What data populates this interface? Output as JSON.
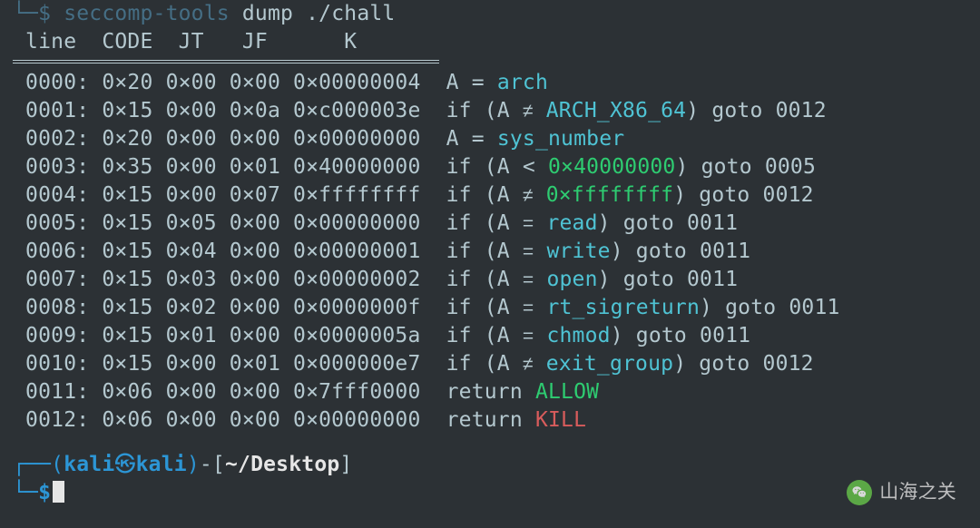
{
  "cmd": {
    "arrow": "└─$ ",
    "tool": "seccomp-tools",
    "sub": " dump ",
    "arg": "./chall"
  },
  "header": " line  CODE  JT   JF      K",
  "rows": [
    {
      "line": "0000",
      "code": "0×20",
      "jt": "0×00",
      "jf": "0×00",
      "k": "0×00000004",
      "desc": {
        "pre": "A = ",
        "hl": "arch",
        "post": ""
      }
    },
    {
      "line": "0001",
      "code": "0×15",
      "jt": "0×00",
      "jf": "0×0a",
      "k": "0×c000003e",
      "desc": {
        "pre": "if (A ",
        "op": "≠",
        "mid": " ",
        "hl": "ARCH_X86_64",
        "post": ") goto 0012"
      }
    },
    {
      "line": "0002",
      "code": "0×20",
      "jt": "0×00",
      "jf": "0×00",
      "k": "0×00000000",
      "desc": {
        "pre": "A = ",
        "hl": "sys_number",
        "post": ""
      }
    },
    {
      "line": "0003",
      "code": "0×35",
      "jt": "0×00",
      "jf": "0×01",
      "k": "0×40000000",
      "desc": {
        "pre": "if (A < ",
        "hl": "0×40000000",
        "post": ") goto 0005",
        "num": true
      }
    },
    {
      "line": "0004",
      "code": "0×15",
      "jt": "0×00",
      "jf": "0×07",
      "k": "0×ffffffff",
      "desc": {
        "pre": "if (A ",
        "op": "≠",
        "mid": " ",
        "hl": "0×ffffffff",
        "post": ") goto 0012",
        "num": true
      }
    },
    {
      "line": "0005",
      "code": "0×15",
      "jt": "0×05",
      "jf": "0×00",
      "k": "0×00000000",
      "desc": {
        "pre": "if (A ",
        "op": "=",
        "mid": " ",
        "hl": "read",
        "post": ") goto 0011"
      }
    },
    {
      "line": "0006",
      "code": "0×15",
      "jt": "0×04",
      "jf": "0×00",
      "k": "0×00000001",
      "desc": {
        "pre": "if (A ",
        "op": "=",
        "mid": " ",
        "hl": "write",
        "post": ") goto 0011"
      }
    },
    {
      "line": "0007",
      "code": "0×15",
      "jt": "0×03",
      "jf": "0×00",
      "k": "0×00000002",
      "desc": {
        "pre": "if (A ",
        "op": "=",
        "mid": " ",
        "hl": "open",
        "post": ") goto 0011"
      }
    },
    {
      "line": "0008",
      "code": "0×15",
      "jt": "0×02",
      "jf": "0×00",
      "k": "0×0000000f",
      "desc": {
        "pre": "if (A ",
        "op": "=",
        "mid": " ",
        "hl": "rt_sigreturn",
        "post": ") goto 0011"
      }
    },
    {
      "line": "0009",
      "code": "0×15",
      "jt": "0×01",
      "jf": "0×00",
      "k": "0×0000005a",
      "desc": {
        "pre": "if (A ",
        "op": "=",
        "mid": " ",
        "hl": "chmod",
        "post": ") goto 0011"
      }
    },
    {
      "line": "0010",
      "code": "0×15",
      "jt": "0×00",
      "jf": "0×01",
      "k": "0×000000e7",
      "desc": {
        "pre": "if (A ",
        "op": "≠",
        "mid": " ",
        "hl": "exit_group",
        "post": ") goto 0012"
      }
    },
    {
      "line": "0011",
      "code": "0×06",
      "jt": "0×00",
      "jf": "0×00",
      "k": "0×7fff0000",
      "desc": {
        "pre": "return ",
        "hl": "ALLOW",
        "post": ""
      }
    },
    {
      "line": "0012",
      "code": "0×06",
      "jt": "0×00",
      "jf": "0×00",
      "k": "0×00000000",
      "desc": {
        "pre": "return ",
        "hl": "KILL",
        "post": ""
      }
    }
  ],
  "prompt": {
    "corner_top": "┌──(",
    "user": "kali",
    "skull": "㉿",
    "host": "kali",
    "close_paren": ")",
    "dash": "-[",
    "path": "~/Desktop",
    "end": "]",
    "corner_bot": "└─",
    "dollar": "$"
  },
  "watermark": "山海之关"
}
